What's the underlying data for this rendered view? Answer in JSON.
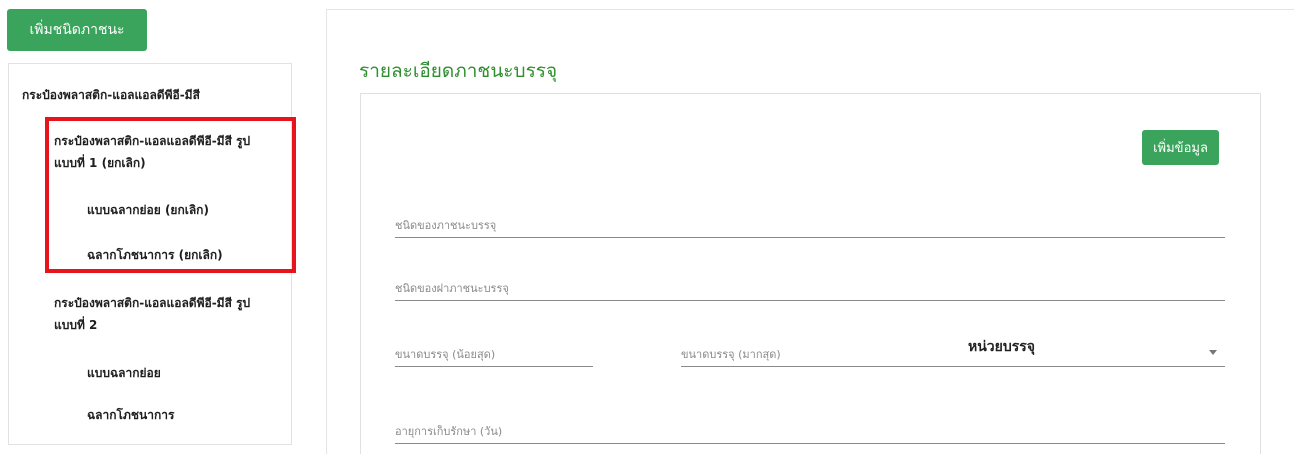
{
  "sidebar": {
    "add_type_button": "เพิ่มชนิดภาชนะ",
    "tree": [
      {
        "label": "กระป๋องพลาสติก-แอลแอลดีพีอี-มีสี"
      },
      {
        "label_line1": "กระป๋องพลาสติก-แอลแอลดีพีอี-มีสี รูป",
        "label_line2": "แบบที่ 1 (ยกเลิก)"
      },
      {
        "label": "แบบฉลากย่อย (ยกเลิก)"
      },
      {
        "label": "ฉลากโภชนาการ (ยกเลิก)"
      },
      {
        "label_line1": "กระป๋องพลาสติก-แอลแอลดีพีอี-มีสี รูป",
        "label_line2": "แบบที่ 2"
      },
      {
        "label": "แบบฉลากย่อย"
      },
      {
        "label": "ฉลากโภชนาการ"
      }
    ]
  },
  "main": {
    "title": "รายละเอียดภาชนะบรรจุ",
    "add_data_button": "เพิ่มข้อมูล",
    "fields": {
      "container_type": {
        "placeholder": "ชนิดของภาชนะบรรจุ",
        "value": ""
      },
      "lid_type": {
        "placeholder": "ชนิดของฝาภาชนะบรรจุ",
        "value": ""
      },
      "size_min": {
        "placeholder": "ขนาดบรรจุ (น้อยสุด)",
        "value": ""
      },
      "size_max": {
        "placeholder": "ขนาดบรรจุ (มากสุด)",
        "value": ""
      },
      "unit_select_label": "หน่วยบรรจุ",
      "shelf_life": {
        "placeholder": "อายุการเก็บรักษา (วัน)",
        "value": ""
      }
    }
  },
  "colors": {
    "primary_green": "#3aa35c",
    "title_green": "#2f8f2f",
    "highlight_red": "#e8141b"
  }
}
